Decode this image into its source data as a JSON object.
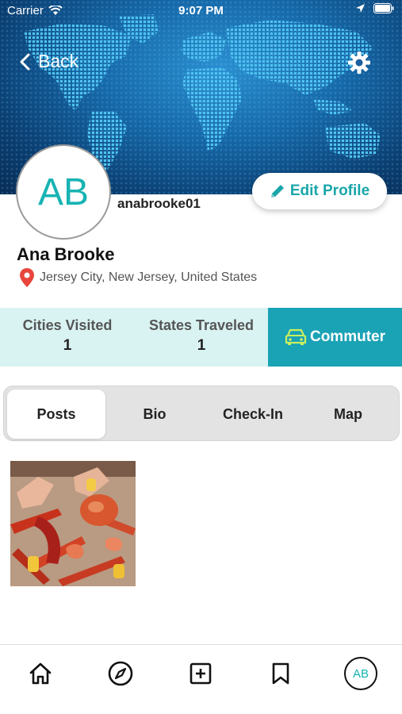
{
  "status_bar": {
    "carrier": "Carrier",
    "time": "9:07 PM"
  },
  "header": {
    "back_label": "Back",
    "settings_icon": "gear-icon"
  },
  "profile": {
    "initials": "AB",
    "username": "anabrooke01",
    "full_name": "Ana Brooke",
    "location": "Jersey City, New Jersey, United States",
    "edit_label": "Edit Profile"
  },
  "stats": [
    {
      "label": "Cities Visited",
      "value": "1"
    },
    {
      "label": "States Traveled",
      "value": "1"
    }
  ],
  "badge": {
    "label": "Commuter",
    "icon": "car-icon"
  },
  "tabs": [
    {
      "label": "Posts",
      "active": true
    },
    {
      "label": "Bio",
      "active": false
    },
    {
      "label": "Check-In",
      "active": false
    },
    {
      "label": "Map",
      "active": false
    }
  ],
  "posts": [
    {
      "image": "seafood-boil-crab-photo"
    }
  ],
  "bottom_nav": [
    {
      "icon": "home-icon"
    },
    {
      "icon": "compass-icon"
    },
    {
      "icon": "add-square-icon"
    },
    {
      "icon": "bookmark-icon"
    },
    {
      "icon": "avatar",
      "initials": "AB"
    }
  ],
  "colors": {
    "accent": "#1aa6a9",
    "badge": "#1aa2b5",
    "stats_bg": "#d9f2f2"
  }
}
